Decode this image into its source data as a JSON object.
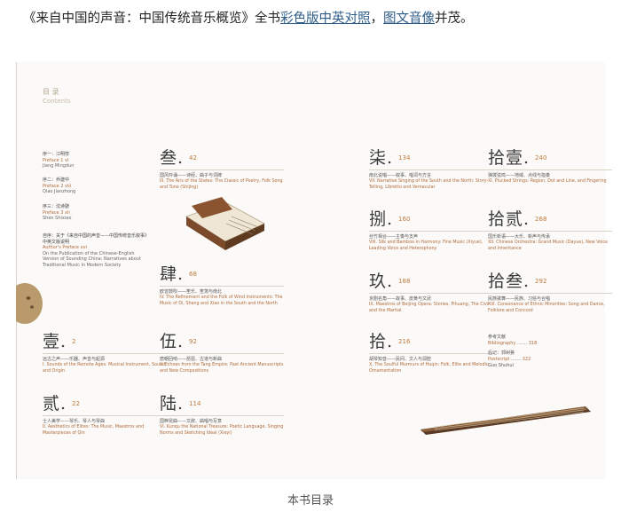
{
  "intro": {
    "before": "《来自中国的声音：中国传统音乐概览》全书",
    "link1": "彩色版中英对照",
    "mid": "，",
    "link2": "图文音像",
    "after": "并茂。"
  },
  "toc": {
    "title": "目 录",
    "title_en": "Contents"
  },
  "prefaces": [
    {
      "zh": "序一：江明惇",
      "en": "Preface 1",
      "page": "vi",
      "author": "Jiang Mingdun"
    },
    {
      "zh": "序二：乔建中",
      "en": "Preface 2",
      "page": "viii",
      "author": "Qiao Jianzhong"
    },
    {
      "zh": "序三：沈诗骁",
      "en": "Preface 3",
      "page": "xii",
      "author": "Shen Shixiao"
    },
    {
      "zh": "自序：关于《来自中国的声音——中国传统音乐叙事》中英文版说明",
      "en": "Author's Preface",
      "page": "xvi",
      "author": "On the Publication of the Chinese-English Version of Sounding China: Narratives about Traditional Music in Modern Society"
    }
  ],
  "chapters": [
    {
      "key": "c1",
      "num": "壹.",
      "page": "2",
      "zh": "远古之声——乐器、声音与起源",
      "en": "I. Sounds of the Remote Ages: Musical Instrument, Sound and Origin"
    },
    {
      "key": "c2",
      "num": "贰.",
      "page": "22",
      "zh": "士人美学——琴乐、琴人与琴曲",
      "en": "II. Aesthetics of Elites: The Music, Maestros and Masterpieces of Qin"
    },
    {
      "key": "c3",
      "num": "叁.",
      "page": "42",
      "zh": "国风吟诵——诗经、曲子与词牌",
      "en": "III. The Airs of the States: The Classic of Poetry, Folk Song and Tune (Shijing)"
    },
    {
      "key": "c4",
      "num": "肆.",
      "page": "68",
      "zh": "欧曾鼓吹——笙乐、笙箫与南北",
      "en": "IV. The Refinement and the Folk of Wind Instruments: The Music of Di, Sheng and Xiao in the South and the North"
    },
    {
      "key": "c5",
      "num": "伍.",
      "page": "92",
      "zh": "唐朝回响——琵琶、古谱与新曲",
      "en": "V. Echoes from the Tang Empire: Past Ancient Manuscripts and New Compositions"
    },
    {
      "key": "c6",
      "num": "陆.",
      "page": "114",
      "zh": "国粹昆曲——文辞、曲唱与写意",
      "en": "VI. Kunqu the National Treasure: Poetic Language, Singing Norms and Sketching Ideal (Xieyi)"
    },
    {
      "key": "c7",
      "num": "柒.",
      "page": "134",
      "zh": "南北说唱——叙事、唱词与方言",
      "en": "VII. Narrative Singing of the South and the North: Story-Telling, Libretto and Vernacular"
    },
    {
      "key": "c8",
      "num": "捌.",
      "page": "160",
      "zh": "丝竹相合——主奏与支声",
      "en": "VIII. Silk and Bamboo in Harmony: Fine Music (Xiyue), Leading Voice and Heterophony"
    },
    {
      "key": "c9",
      "num": "玖.",
      "page": "188",
      "zh": "京剧名角——故事、皮黄与文武",
      "en": "IX. Maestros of Beijing Opera: Stories, Pihuang, The Civil and the Martial"
    },
    {
      "key": "c10",
      "num": "拾.",
      "page": "216",
      "zh": "胡琴知音——民间、文人与润腔",
      "en": "X. The Soulful Murmurs of Huqin: Folk, Elite and Melodic Ornamentation"
    },
    {
      "key": "c11",
      "num": "拾壹.",
      "page": "240",
      "zh": "弹拨弦鸣——地域、点线与指奏",
      "en": "XI. Plucked Strings: Region, Dot and Line, and Fingering"
    },
    {
      "key": "c12",
      "num": "拾贰.",
      "page": "268",
      "zh": "国乐新语——大乐、新声与传承",
      "en": "XII. Chinese Orchestra: Grand Music (Dayue), New Voice and Inheritance"
    },
    {
      "key": "c13",
      "num": "拾叁.",
      "page": "292",
      "zh": "民族歌舞——民族、习俗与合唱",
      "en": "XIII. Consonance of Ethnic Minorities: Song and Dance, Folklore and Concord"
    }
  ],
  "refs": {
    "zh": "参考文献",
    "en": "Bibliography",
    "page": "318",
    "post_zh": "后记：郭树荟",
    "post_en": "Postscript",
    "post_page": "322",
    "post_author": "Guo Shuhui"
  },
  "caption": "本书目录"
}
